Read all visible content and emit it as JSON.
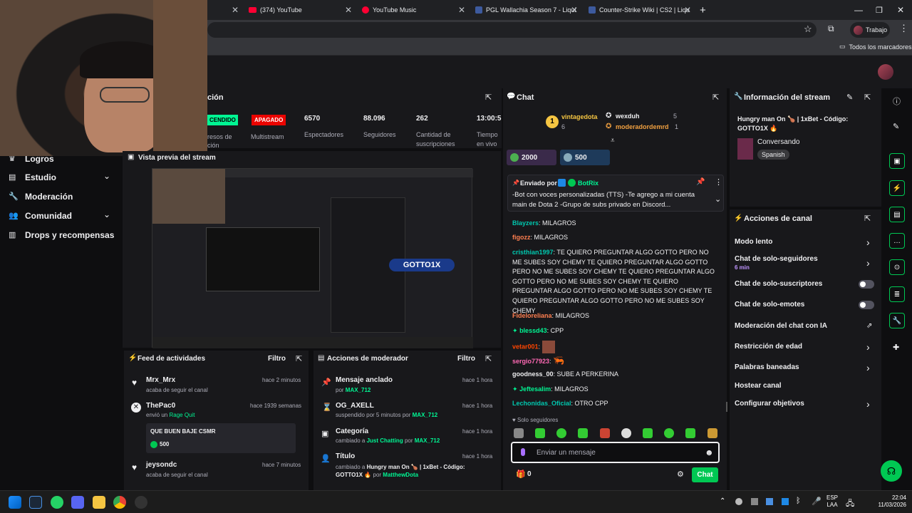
{
  "browser": {
    "tabs": [
      {
        "label": "(374) YouTube",
        "icon": "youtube-icon"
      },
      {
        "label": "YouTube Music",
        "icon": "youtube-music-icon"
      },
      {
        "label": "PGL Wallachia Season 7 - Liqui",
        "icon": "liquipedia-icon"
      },
      {
        "label": "Counter-Strike Wiki | CS2 | Liqu",
        "icon": "liquipedia-icon"
      }
    ],
    "profile_label": "Trabajo",
    "bookmarks_label": "Todos los marcadores"
  },
  "stats": {
    "section_title": "ción",
    "tag_live": "CENDIDO",
    "tag_multistream": "APAGADO",
    "multistream_label": "Multistream",
    "partial_label_1": "resos de",
    "partial_label_2": "ción",
    "viewers_value": "6570",
    "viewers_label": "Espectadores",
    "followers_value": "88.096",
    "followers_label": "Seguidores",
    "subs_value": "262",
    "subs_label_1": "Cantidad de",
    "subs_label_2": "suscripciones",
    "time_value": "13:00:5",
    "time_label_1": "Tiempo",
    "time_label_2": "en vivo"
  },
  "sidebar": {
    "items": [
      {
        "label": "Logros"
      },
      {
        "label": "Estudio"
      },
      {
        "label": "Moderación"
      },
      {
        "label": "Comunidad"
      },
      {
        "label": "Drops y recompensas"
      }
    ]
  },
  "preview": {
    "title": "Vista previa del stream",
    "overlay_text": "GOTTO1X"
  },
  "activity_feed": {
    "title": "Feed de actividades",
    "filter": "Filtro",
    "items": [
      {
        "user": "Mrx_Mrx",
        "desc": "acaba de seguir el canal",
        "time": "hace 2 minutos"
      },
      {
        "user": "ThePac0",
        "desc": "envió un",
        "link": "Rage Quit",
        "time": "hace 1939 semanas"
      },
      {
        "message": "QUE BUEN BAJE CSMR",
        "amount": "500"
      },
      {
        "user": "jeysondc",
        "desc": "acaba de seguir el canal",
        "time": "hace 7 minutos"
      }
    ]
  },
  "mod_actions": {
    "title": "Acciones de moderador",
    "filter": "Filtro",
    "items": [
      {
        "title": "Mensaje anclado",
        "desc": "por",
        "by": "MAX_712",
        "time": "hace 1 hora"
      },
      {
        "title": "OG_AXELL",
        "desc": "suspendido por 5 minutos por",
        "by": "MAX_712",
        "time": "hace 1 hora"
      },
      {
        "title": "Categoría",
        "desc": "cambiado a",
        "link": "Just Chatting",
        "desc2": "por",
        "by": "MAX_712",
        "time": "hace 1 hora"
      },
      {
        "title": "Título",
        "desc": "cambiado a",
        "bold": "Hungry man On 🍗 | 1xBet - Código:",
        "bold2": "GOTTO1X 🔥",
        "desc2": "por",
        "by": "MatthewDota",
        "time": "hace 1 hora"
      }
    ]
  },
  "chat": {
    "title": "Chat",
    "leaderboard": [
      {
        "rank": "1",
        "name": "vintagedota",
        "count": "6"
      },
      {
        "name": "wexduh",
        "count": "5"
      },
      {
        "name": "moderadordemrd",
        "count": "1"
      }
    ],
    "bits_1": "2000",
    "bits_2": "500",
    "pinned_by_label": "Enviado por",
    "pinned_by": "BotRix",
    "pinned_text": "-Bot con voces personalizadas (TTS) -Te agrego a mi cuenta main de Dota 2 -Grupo de subs privado en Discord...",
    "messages": [
      {
        "user": "Blayzers",
        "color": "#00c8af",
        "text": ": MILAGROS"
      },
      {
        "user": "figozz",
        "color": "#ff7f50",
        "text": ": MILAGROS"
      },
      {
        "user": "cristhian1997",
        "color": "#00c8af",
        "text": ": TE QUIERO PREGUNTAR ALGO GOTTO PERO NO ME SUBES SOY CHEMY TE QUIERO PREGUNTAR ALGO GOTTO PERO NO ME SUBES SOY CHEMY TE QUIERO PREGUNTAR ALGO GOTTO PERO NO ME SUBES SOY CHEMY TE QUIERO PREGUNTAR ALGO GOTTO PERO NO ME SUBES SOY CHEMY TE QUIERO PREGUNTAR ALGO GOTTO PERO NO ME SUBES SOY CHEMY"
      },
      {
        "user": "Fideloreliana",
        "color": "#ff7f50",
        "text": ": MILAGROS"
      },
      {
        "user": "blessd43",
        "color": "#00f593",
        "text": ": CPP"
      },
      {
        "user": "vetar001",
        "color": "#ff4500",
        "text": ":"
      },
      {
        "user": "sergio77923",
        "color": "#ff69b4",
        "text": ":"
      },
      {
        "user": "goodness_00",
        "color": "#efeff1",
        "text": ": SUBE A PERKERINA"
      },
      {
        "user": "Jeftesalim",
        "color": "#00f593",
        "text": ": MILAGROS"
      },
      {
        "user": "Lechonidas_Oficial",
        "color": "#00c8af",
        "text": ": OTRO CPP"
      }
    ],
    "followers_only": "Solo seguidores",
    "input_placeholder": "Enviar un mensaje",
    "points": "0",
    "send_label": "Chat"
  },
  "stream_info": {
    "title": "Información del stream",
    "stream_title": "Hungry man On 🍗 | 1xBet - Código: GOTTO1X 🔥",
    "category": "Conversando",
    "language": "Spanish"
  },
  "channel_actions": {
    "title": "Acciones de canal",
    "items": [
      {
        "label": "Modo lento"
      },
      {
        "label": "Chat de solo-seguidores",
        "sub": "6 min"
      },
      {
        "label": "Chat de solo-suscriptores"
      },
      {
        "label": "Chat de solo-emotes"
      },
      {
        "label": "Moderación del chat con IA"
      },
      {
        "label": "Restricción de edad"
      },
      {
        "label": "Palabras baneadas"
      },
      {
        "label": "Hostear canal"
      },
      {
        "label": "Configurar objetivos"
      }
    ]
  },
  "taskbar": {
    "lang_1": "ESP",
    "lang_2": "LAA",
    "time": "22:04",
    "date": "11/03/2026"
  }
}
